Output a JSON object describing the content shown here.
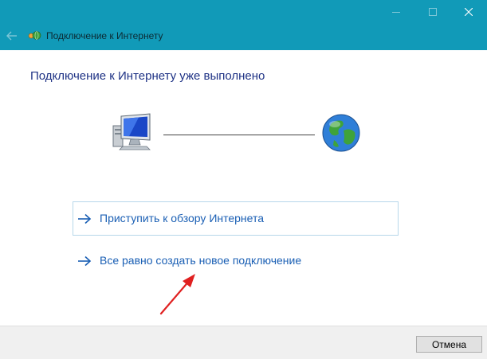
{
  "window": {
    "title": "Подключение к Интернету",
    "title_icon": "network-globe-icon",
    "back_icon": "back-arrow-icon",
    "controls": {
      "minimize_icon": "minimize-icon",
      "maximize_icon": "maximize-icon",
      "close_icon": "close-icon"
    }
  },
  "main": {
    "heading": "Подключение к Интернету уже выполнено",
    "diagram": {
      "left_icon": "computer-monitor-icon",
      "right_icon": "internet-globe-icon"
    },
    "links": [
      {
        "label": "Приступить к обзору Интернета",
        "icon": "arrow-right-icon"
      },
      {
        "label": "Все равно создать новое подключение",
        "icon": "arrow-right-icon"
      }
    ],
    "annotation_icon": "red-arrow-pointer-icon"
  },
  "footer": {
    "cancel_label": "Отмена"
  },
  "colors": {
    "titlebar": "#119ab8",
    "heading": "#1e3285",
    "link": "#1a5fb4",
    "annotation": "#e02020"
  }
}
